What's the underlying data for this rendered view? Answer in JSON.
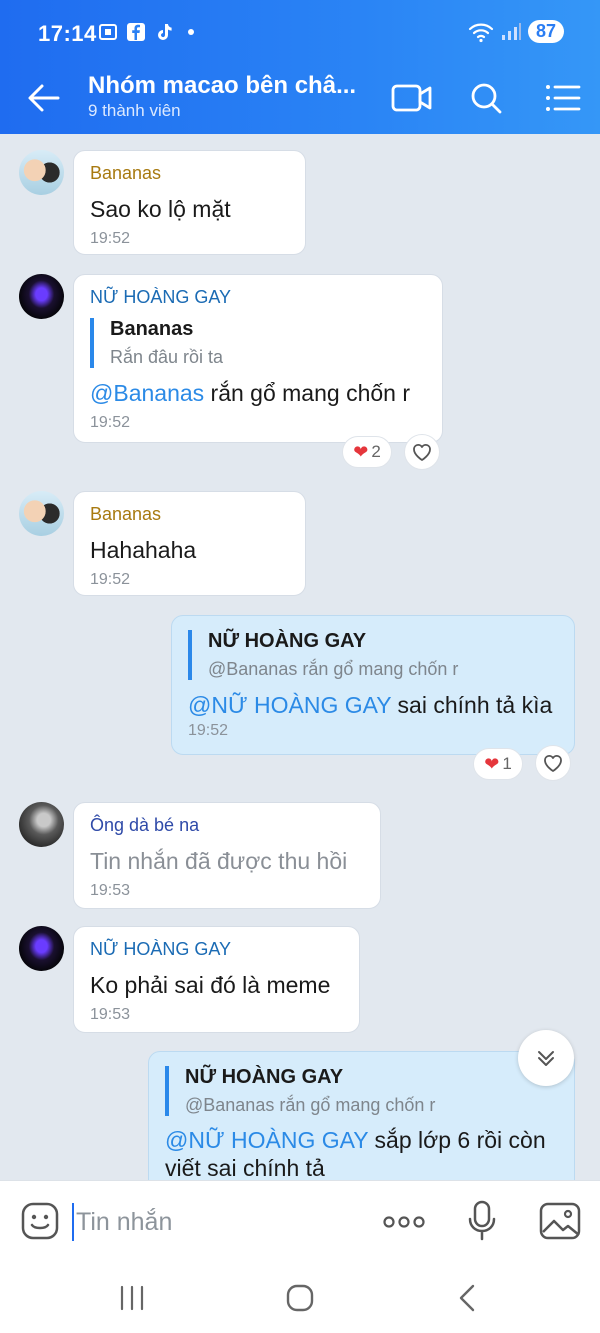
{
  "status_bar": {
    "time": "17:14",
    "battery": "87"
  },
  "header": {
    "title": "Nhóm macao bên châ...",
    "subtitle": "9 thành viên",
    "icons": [
      "back-arrow-icon",
      "video-call-icon",
      "search-icon",
      "menu-list-icon"
    ]
  },
  "messages": [
    {
      "sender": "Bananas",
      "text": "Sao ko lộ mặt",
      "time": "19:52"
    },
    {
      "sender": "NỮ HOÀNG GAY",
      "quote": {
        "name": "Bananas",
        "text": "Rắn đâu rồi ta"
      },
      "mention": "@Bananas",
      "text": " rắn gổ mang chốn r",
      "time": "19:52",
      "reaction_count": "2"
    },
    {
      "sender": "Bananas",
      "text": "Hahahaha",
      "time": "19:52"
    },
    {
      "quote": {
        "name": "NỮ HOÀNG GAY",
        "text": "@Bananas rắn gổ mang chốn r"
      },
      "mention": "@NỮ HOÀNG GAY",
      "text": " sai chính tả kìa",
      "time": "19:52",
      "reaction_count": "1"
    },
    {
      "sender": "Ông dà bé na",
      "text": "Tin nhắn đã được thu hồi",
      "time": "19:53"
    },
    {
      "sender": "NỮ HOÀNG GAY",
      "text": "Ko phải sai đó là meme",
      "time": "19:53"
    },
    {
      "quote": {
        "name": "NỮ HOÀNG GAY",
        "text": "@Bananas rắn gổ mang chốn r"
      },
      "mention": "@NỮ HOÀNG GAY",
      "text": " sắp lớp 6 rồi còn viết sai chính tả"
    }
  ],
  "input": {
    "placeholder": "Tin nhắn"
  },
  "colors": {
    "header": "#1f6cf0",
    "mention": "#2b8ae6",
    "mine_bubble": "#d6ecfb"
  }
}
